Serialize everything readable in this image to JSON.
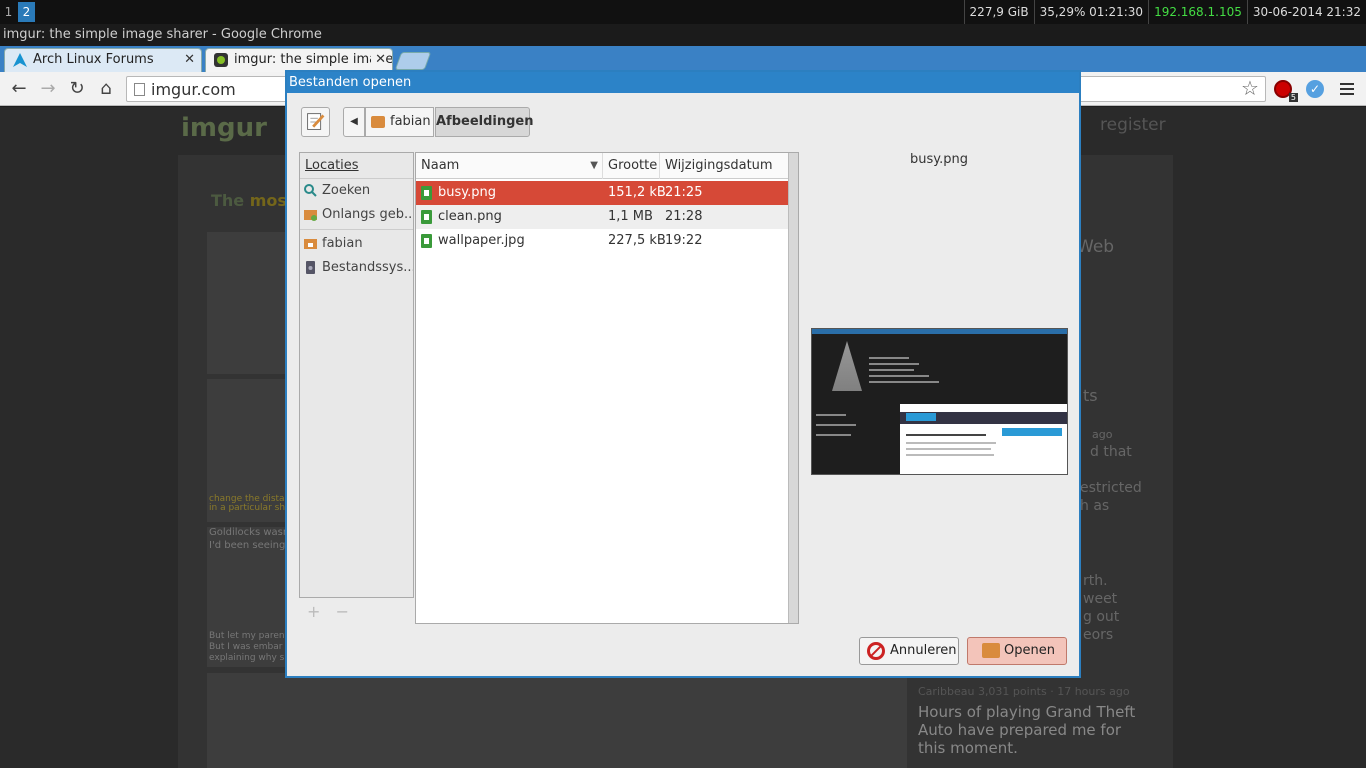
{
  "wm": {
    "workspaces": [
      "1",
      "2"
    ],
    "status": {
      "disk": "227,9 GiB",
      "battery": "35,29% 01:21:30",
      "ip": "192.168.1.105",
      "datetime": "30-06-2014 21:32"
    },
    "window_title": "imgur: the simple image sharer - Google Chrome"
  },
  "browser": {
    "tabs": [
      {
        "label": "Arch Linux Forums",
        "icon": "arch-logo-icon"
      },
      {
        "label": "imgur: the simple image sharer",
        "icon": "imgur-favicon-icon"
      }
    ],
    "url": "imgur.com",
    "extension_badge": "5"
  },
  "page": {
    "logo": "imgur",
    "register": "register",
    "tagline_prefix": "The",
    "tagline_highlight": "mos",
    "web_label": "Web",
    "side_fragments": [
      "ts",
      "ago",
      "d that",
      "estricted",
      "h as"
    ],
    "thumb_texts": [
      "change the distance",
      "in a particular sho",
      "Goldilocks wasn",
      "I'd been seeing h",
      "But let my parents re",
      "But I was embar",
      "explaining why sh"
    ],
    "side_fragments_2": [
      "rth.",
      "weet",
      "g out",
      "eors"
    ],
    "caption_meta": "Caribbeau 3,031 points · 17 hours ago",
    "caption_body": "Hours of playing Grand Theft Auto have prepared me for this moment."
  },
  "dialog": {
    "title": "Bestanden openen",
    "breadcrumbs": [
      "fabian",
      "Afbeeldingen"
    ],
    "places_header": "Locaties",
    "places": [
      {
        "label": "Zoeken",
        "icon": "search-icon"
      },
      {
        "label": "Onlangs geb...",
        "icon": "recent-icon"
      },
      {
        "label": "fabian",
        "icon": "home-folder-icon"
      },
      {
        "label": "Bestandssys...",
        "icon": "drive-icon"
      }
    ],
    "columns": {
      "name": "Naam",
      "size": "Grootte",
      "date": "Wijzigingsdatum"
    },
    "files": [
      {
        "name": "busy.png",
        "size": "151,2 kB",
        "date": "21:25",
        "selected": true
      },
      {
        "name": "clean.png",
        "size": "1,1 MB",
        "date": "21:28",
        "selected": false
      },
      {
        "name": "wallpaper.jpg",
        "size": "227,5 kB",
        "date": "19:22",
        "selected": false
      }
    ],
    "preview_name": "busy.png",
    "cancel": "Annuleren",
    "open": "Openen"
  },
  "colors": {
    "accent": "#2c83c8",
    "selection": "#d64937",
    "ip_green": "#44dd44"
  }
}
